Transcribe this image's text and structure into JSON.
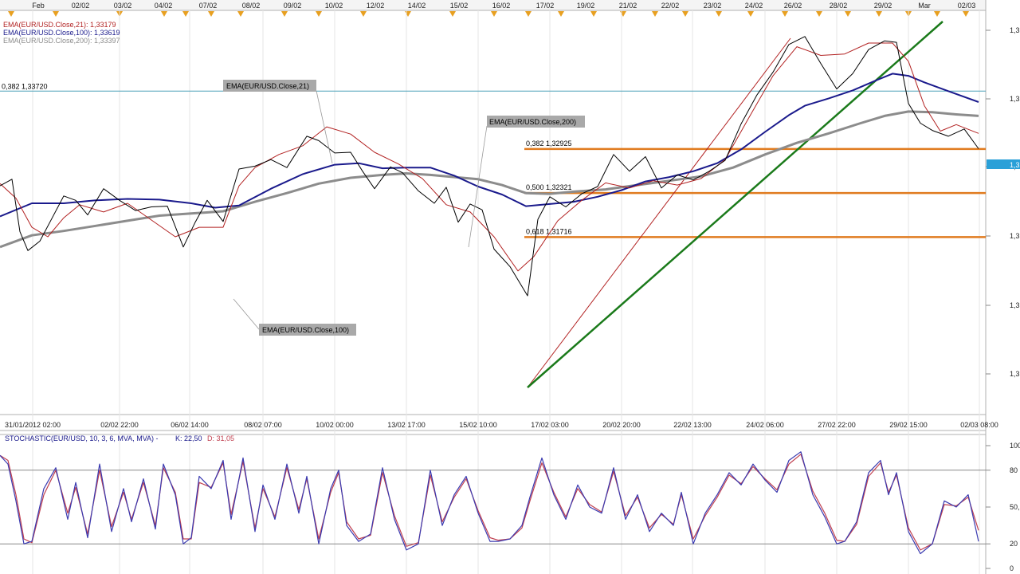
{
  "colors": {
    "ema21": "#b22222",
    "ema100": "#1a1a8c",
    "ema200": "#8c8c8c",
    "fib": "#e07b1f",
    "trend": "#1a7a1a",
    "stoch_k": "#3a3ab0",
    "stoch_d": "#c04050",
    "level_line": "#4aa0b8",
    "price": "#000000",
    "marker": "#e8a020"
  },
  "chart_data": [
    {
      "type": "line",
      "instrument": "EUR/USD",
      "top_dates": [
        "Feb",
        "02/02",
        "03/02",
        "04/02",
        "07/02",
        "08/02",
        "09/02",
        "10/02",
        "12/02",
        "14/02",
        "15/02",
        "16/02",
        "17/02",
        "19/02",
        "21/02",
        "22/02",
        "23/02",
        "24/02",
        "26/02",
        "28/02",
        "29/02",
        "Mar",
        "02/03"
      ],
      "bottom_ticks": [
        "31/01/2012 02:00",
        "02/02 22:00",
        "06/02 14:00",
        "08/02 07:00",
        "10/02 00:00",
        "13/02 17:00",
        "15/02 10:00",
        "17/02 03:00",
        "20/02 20:00",
        "22/02 13:00",
        "24/02 06:00",
        "27/02 22:00",
        "29/02 15:00",
        "02/03 08:00"
      ],
      "y_ticks": [
        "1,3",
        "1,3",
        "1,3",
        "1,3",
        "1,3",
        "1,3"
      ],
      "legend": [
        {
          "label": "EMA(EUR/USD.Close,21): 1,33179",
          "color": "#b22222"
        },
        {
          "label": "EMA(EUR/USD.Close,100): 1,33619",
          "color": "#1a1a8c"
        },
        {
          "label": "EMA(EUR/USD.Close,200): 1,33397",
          "color": "#8c8c8c"
        }
      ],
      "callouts": [
        "EMA(EUR/USD.Close,21)",
        "EMA(EUR/USD.Close,200)",
        "EMA(EUR/USD.Close,100)"
      ],
      "levels": [
        {
          "label": "0,382 1,33720",
          "value": 1.3372
        },
        {
          "label": "0,382 1,32925",
          "value": 1.32925
        },
        {
          "label": "0,500 1,32321",
          "value": 1.32321
        },
        {
          "label": "0,618 1,31716",
          "value": 1.31716
        }
      ],
      "ylim": [
        1.2941,
        1.3484
      ],
      "current_price_tag": "1,3",
      "series": [
        {
          "name": "EMA(EUR/USD.Close,21)",
          "x": [
            0,
            20,
            40,
            60,
            80,
            100,
            130,
            160,
            190,
            220,
            250,
            280,
            300,
            320,
            350,
            380,
            410,
            440,
            470,
            500,
            530,
            560,
            590,
            620,
            650,
            670,
            700,
            730,
            760,
            790,
            820,
            850,
            880,
            910,
            940,
            970,
            1000,
            1030,
            1060,
            1090,
            1120,
            1140,
            1160,
            1180,
            1200,
            1228
          ],
          "values": [
            1.3245,
            1.3225,
            1.3185,
            1.3172,
            1.3198,
            1.3216,
            1.3206,
            1.3218,
            1.3195,
            1.3172,
            1.3185,
            1.3185,
            1.3242,
            1.3267,
            1.3285,
            1.3297,
            1.3323,
            1.3313,
            1.3288,
            1.3272,
            1.3252,
            1.3216,
            1.3206,
            1.3172,
            1.3125,
            1.3145,
            1.3194,
            1.3222,
            1.3246,
            1.3239,
            1.3249,
            1.3243,
            1.3252,
            1.3278,
            1.3336,
            1.3393,
            1.3433,
            1.3421,
            1.3423,
            1.3438,
            1.3438,
            1.3413,
            1.3352,
            1.3317,
            1.3326,
            1.3314
          ]
        },
        {
          "name": "EMA(EUR/USD.Close,100)",
          "x": [
            0,
            40,
            80,
            120,
            160,
            200,
            240,
            270,
            300,
            340,
            380,
            420,
            450,
            480,
            510,
            540,
            570,
            600,
            630,
            660,
            690,
            720,
            750,
            780,
            810,
            840,
            870,
            900,
            930,
            960,
            990,
            1010,
            1040,
            1070,
            1100,
            1120,
            1140,
            1160,
            1190,
            1228
          ],
          "values": [
            1.32,
            1.3218,
            1.3218,
            1.3222,
            1.3224,
            1.3223,
            1.3218,
            1.3212,
            1.3215,
            1.3238,
            1.3258,
            1.3271,
            1.3273,
            1.3266,
            1.3267,
            1.3267,
            1.3256,
            1.3241,
            1.323,
            1.3214,
            1.3217,
            1.322,
            1.3227,
            1.3236,
            1.3248,
            1.3254,
            1.3262,
            1.3273,
            1.3292,
            1.3316,
            1.3339,
            1.3352,
            1.3362,
            1.3373,
            1.3387,
            1.3396,
            1.3393,
            1.3384,
            1.3372,
            1.3357
          ]
        },
        {
          "name": "EMA(EUR/USD.Close,200)",
          "x": [
            0,
            40,
            80,
            120,
            160,
            200,
            240,
            280,
            320,
            360,
            400,
            440,
            480,
            510,
            540,
            570,
            600,
            630,
            660,
            690,
            720,
            760,
            800,
            840,
            880,
            920,
            960,
            1000,
            1040,
            1080,
            1110,
            1140,
            1170,
            1200,
            1228
          ],
          "values": [
            1.3158,
            1.3174,
            1.318,
            1.3187,
            1.3194,
            1.3201,
            1.3204,
            1.3207,
            1.322,
            1.3232,
            1.3245,
            1.3253,
            1.3257,
            1.3259,
            1.3257,
            1.3254,
            1.3251,
            1.3243,
            1.3232,
            1.3231,
            1.3234,
            1.3237,
            1.3243,
            1.3249,
            1.3255,
            1.3267,
            1.3285,
            1.3301,
            1.3314,
            1.3328,
            1.3338,
            1.3344,
            1.3343,
            1.334,
            1.3338
          ]
        },
        {
          "name": "EUR/USD",
          "x": [
            0,
            15,
            25,
            35,
            50,
            65,
            80,
            95,
            110,
            130,
            150,
            170,
            190,
            210,
            230,
            245,
            260,
            280,
            300,
            320,
            340,
            360,
            385,
            400,
            420,
            440,
            455,
            470,
            490,
            505,
            525,
            545,
            560,
            575,
            590,
            605,
            620,
            640,
            662,
            675,
            690,
            710,
            730,
            750,
            770,
            790,
            810,
            830,
            850,
            870,
            890,
            910,
            930,
            950,
            970,
            990,
            1010,
            1030,
            1050,
            1070,
            1090,
            1110,
            1125,
            1140,
            1155,
            1170,
            1190,
            1210,
            1228
          ],
          "values": [
            1.3242,
            1.3251,
            1.3179,
            1.3153,
            1.3166,
            1.3197,
            1.3228,
            1.3222,
            1.3202,
            1.3238,
            1.3222,
            1.3208,
            1.3213,
            1.3214,
            1.3158,
            1.3192,
            1.3222,
            1.3193,
            1.3265,
            1.3269,
            1.3278,
            1.3267,
            1.331,
            1.3304,
            1.3287,
            1.3288,
            1.3262,
            1.3238,
            1.3268,
            1.326,
            1.3235,
            1.3218,
            1.324,
            1.3192,
            1.3217,
            1.3209,
            1.3155,
            1.3131,
            1.3091,
            1.3196,
            1.3227,
            1.3213,
            1.3231,
            1.3241,
            1.3285,
            1.3262,
            1.3282,
            1.3239,
            1.3257,
            1.325,
            1.3262,
            1.3277,
            1.3327,
            1.3367,
            1.3398,
            1.3436,
            1.3447,
            1.341,
            1.3375,
            1.3396,
            1.3429,
            1.3441,
            1.3439,
            1.3355,
            1.3328,
            1.3318,
            1.331,
            1.332,
            1.3293
          ]
        }
      ]
    },
    {
      "type": "line",
      "title": "STOCHASTIC(EUR/USD, 10, 3, 6, MVA, MVA) -",
      "k_label": "K: 22,50",
      "d_label": "D: 31,05",
      "ylim": [
        0,
        100
      ],
      "y_ticks": [
        "100",
        "80",
        "50,",
        "20",
        "0"
      ],
      "reference_lines": [
        80,
        20
      ],
      "series": [
        {
          "name": "K",
          "x": [
            0,
            10,
            20,
            30,
            40,
            55,
            70,
            85,
            95,
            110,
            125,
            140,
            155,
            165,
            180,
            195,
            205,
            220,
            230,
            240,
            250,
            265,
            280,
            290,
            305,
            320,
            330,
            345,
            360,
            375,
            385,
            400,
            415,
            425,
            435,
            450,
            465,
            480,
            495,
            510,
            525,
            540,
            555,
            570,
            585,
            600,
            615,
            625,
            640,
            655,
            665,
            680,
            695,
            710,
            725,
            740,
            755,
            770,
            785,
            800,
            815,
            830,
            845,
            855,
            870,
            885,
            900,
            915,
            930,
            945,
            960,
            975,
            990,
            1005,
            1020,
            1035,
            1050,
            1060,
            1075,
            1090,
            1105,
            1115,
            1125,
            1140,
            1155,
            1170,
            1185,
            1200,
            1215,
            1228
          ],
          "values": [
            92,
            85,
            55,
            20,
            22,
            65,
            82,
            40,
            70,
            25,
            85,
            30,
            65,
            38,
            73,
            32,
            85,
            60,
            20,
            25,
            75,
            65,
            88,
            40,
            90,
            30,
            68,
            40,
            85,
            45,
            75,
            20,
            65,
            80,
            35,
            22,
            28,
            82,
            40,
            15,
            20,
            80,
            35,
            60,
            75,
            45,
            22,
            22,
            24,
            35,
            58,
            90,
            60,
            40,
            68,
            50,
            45,
            82,
            40,
            60,
            30,
            45,
            35,
            62,
            20,
            45,
            60,
            78,
            68,
            85,
            72,
            62,
            88,
            95,
            60,
            42,
            20,
            22,
            38,
            78,
            88,
            60,
            78,
            30,
            12,
            20,
            55,
            50,
            60,
            22
          ]
        },
        {
          "name": "D",
          "x": [
            0,
            10,
            20,
            30,
            40,
            55,
            70,
            85,
            95,
            110,
            125,
            140,
            155,
            165,
            180,
            195,
            205,
            220,
            230,
            240,
            250,
            265,
            280,
            290,
            305,
            320,
            330,
            345,
            360,
            375,
            385,
            400,
            415,
            425,
            435,
            450,
            465,
            480,
            495,
            510,
            525,
            540,
            555,
            570,
            585,
            600,
            615,
            625,
            640,
            655,
            665,
            680,
            695,
            710,
            725,
            740,
            755,
            770,
            785,
            800,
            815,
            830,
            845,
            855,
            870,
            885,
            900,
            915,
            930,
            945,
            960,
            975,
            990,
            1005,
            1020,
            1035,
            1050,
            1060,
            1075,
            1090,
            1105,
            1115,
            1125,
            1140,
            1155,
            1170,
            1185,
            1200,
            1215,
            1228
          ],
          "values": [
            92,
            88,
            60,
            24,
            21,
            60,
            80,
            45,
            66,
            28,
            80,
            34,
            62,
            40,
            70,
            35,
            82,
            62,
            24,
            24,
            70,
            66,
            86,
            44,
            87,
            33,
            65,
            42,
            82,
            48,
            73,
            24,
            62,
            78,
            38,
            24,
            27,
            78,
            43,
            18,
            21,
            76,
            38,
            58,
            73,
            47,
            25,
            23,
            24,
            33,
            55,
            86,
            62,
            42,
            65,
            52,
            46,
            79,
            43,
            58,
            33,
            44,
            36,
            60,
            24,
            43,
            58,
            76,
            69,
            83,
            73,
            64,
            85,
            93,
            63,
            45,
            23,
            22,
            36,
            75,
            86,
            62,
            76,
            33,
            15,
            20,
            52,
            51,
            58,
            31
          ]
        }
      ]
    }
  ]
}
